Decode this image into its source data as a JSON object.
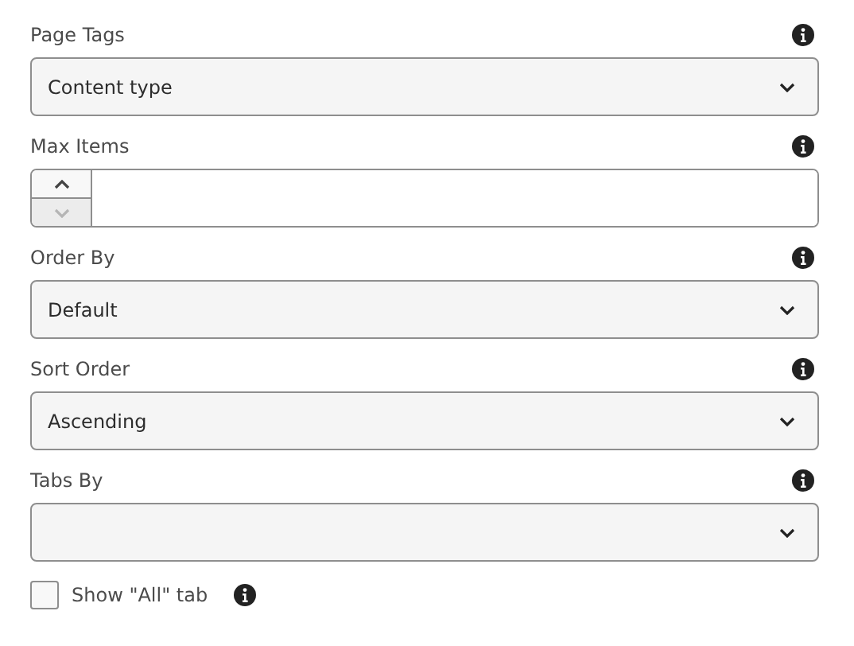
{
  "fields": [
    {
      "kind": "select",
      "label": "Page Tags",
      "value": "Content type"
    },
    {
      "kind": "number",
      "label": "Max Items",
      "down_disabled": true
    },
    {
      "kind": "select",
      "label": "Order By",
      "value": "Default"
    },
    {
      "kind": "select",
      "label": "Sort Order",
      "value": "Ascending"
    },
    {
      "kind": "select",
      "label": "Tabs By"
    }
  ],
  "checkbox": {
    "label": "Show \"All\" tab",
    "checked": false
  }
}
